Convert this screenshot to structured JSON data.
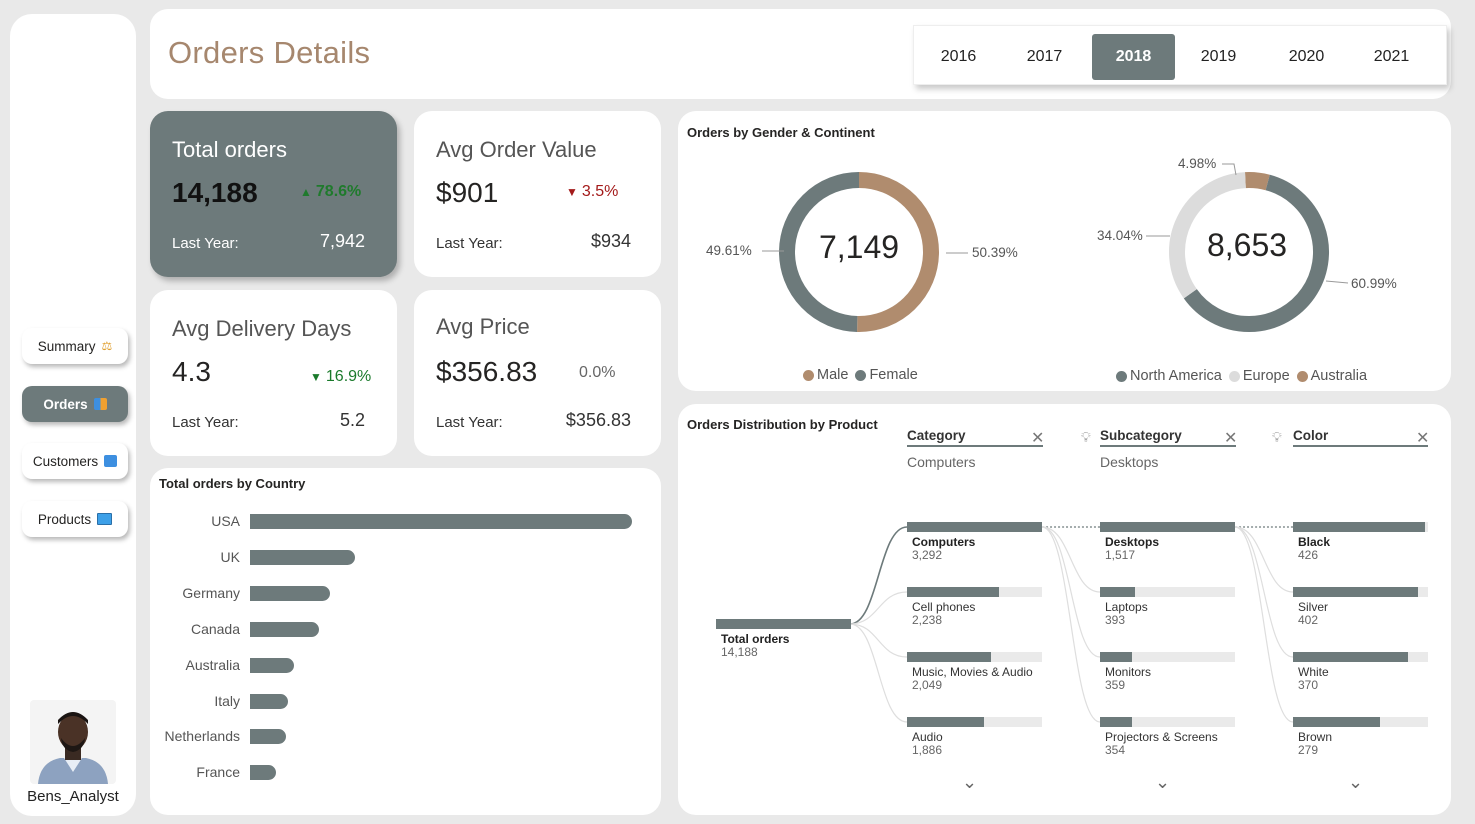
{
  "sidebar": {
    "items": [
      {
        "label": "Summary",
        "icon": "scales-icon"
      },
      {
        "label": "Orders",
        "icon": "chart-icon"
      },
      {
        "label": "Customers",
        "icon": "person-icon"
      },
      {
        "label": "Products",
        "icon": "monitor-icon"
      }
    ],
    "active": "Orders",
    "analyst": "Bens_Analyst"
  },
  "header": {
    "title": "Orders Details",
    "years": [
      "2016",
      "2017",
      "2018",
      "2019",
      "2020",
      "2021"
    ],
    "selected_year": "2018"
  },
  "kpis": {
    "total_orders": {
      "title": "Total orders",
      "value": "14,188",
      "change": "78.6%",
      "direction": "up",
      "last_year_label": "Last Year:",
      "last_year": "7,942"
    },
    "avg_order_value": {
      "title": "Avg Order Value",
      "value": "$901",
      "change": "3.5%",
      "direction": "down",
      "last_year_label": "Last Year:",
      "last_year": "$934"
    },
    "avg_delivery_days": {
      "title": "Avg Delivery Days",
      "value": "4.3",
      "change": "16.9%",
      "direction": "down-good",
      "last_year_label": "Last Year:",
      "last_year": "5.2"
    },
    "avg_price": {
      "title": "Avg Price",
      "value": "$356.83",
      "change": "0.0%",
      "direction": "flat",
      "last_year_label": "Last Year:",
      "last_year": "$356.83"
    }
  },
  "country_chart": {
    "title": "Total orders by Country",
    "chart_data": {
      "type": "bar",
      "categories": [
        "USA",
        "UK",
        "Germany",
        "Canada",
        "Australia",
        "Italy",
        "Netherlands",
        "France"
      ],
      "values": [
        5350,
        1470,
        1120,
        960,
        610,
        530,
        500,
        360
      ]
    }
  },
  "gender_continent": {
    "title": "Orders by Gender & Continent",
    "gender": {
      "center": "7,149",
      "chart_data": {
        "type": "pie",
        "categories": [
          "Male",
          "Female"
        ],
        "values": [
          50.39,
          49.61
        ],
        "labels": [
          "50.39%",
          "49.61%"
        ],
        "colors": [
          "#b08c6e",
          "#6d7a7b"
        ]
      }
    },
    "continent": {
      "center": "8,653",
      "chart_data": {
        "type": "pie",
        "categories": [
          "North America",
          "Europe",
          "Australia"
        ],
        "values": [
          60.99,
          34.04,
          4.98
        ],
        "labels": [
          "60.99%",
          "34.04%",
          "4.98%"
        ],
        "colors": [
          "#6d7a7b",
          "#dcdcdc",
          "#b08c6e"
        ]
      }
    }
  },
  "decomposition": {
    "title": "Orders Distribution by Product",
    "levels": [
      {
        "label": "Category",
        "selected": "Computers"
      },
      {
        "label": "Subcategory",
        "selected": "Desktops"
      },
      {
        "label": "Color",
        "selected": ""
      }
    ],
    "root": {
      "label": "Total orders",
      "value": "14,188"
    },
    "chart_data": {
      "type": "bar",
      "series": [
        {
          "name": "Category",
          "categories": [
            "Computers",
            "Cell phones",
            "Music, Movies & Audio",
            "Audio"
          ],
          "values": [
            3292,
            2238,
            2049,
            1886
          ],
          "labels": [
            "3,292",
            "2,238",
            "2,049",
            "1,886"
          ]
        },
        {
          "name": "Subcategory",
          "categories": [
            "Desktops",
            "Laptops",
            "Monitors",
            "Projectors & Screens"
          ],
          "values": [
            1517,
            393,
            359,
            354
          ],
          "labels": [
            "1,517",
            "393",
            "359",
            "354"
          ]
        },
        {
          "name": "Color",
          "categories": [
            "Black",
            "Silver",
            "White",
            "Brown"
          ],
          "values": [
            426,
            402,
            370,
            279
          ],
          "labels": [
            "426",
            "402",
            "370",
            "279"
          ]
        }
      ]
    }
  }
}
